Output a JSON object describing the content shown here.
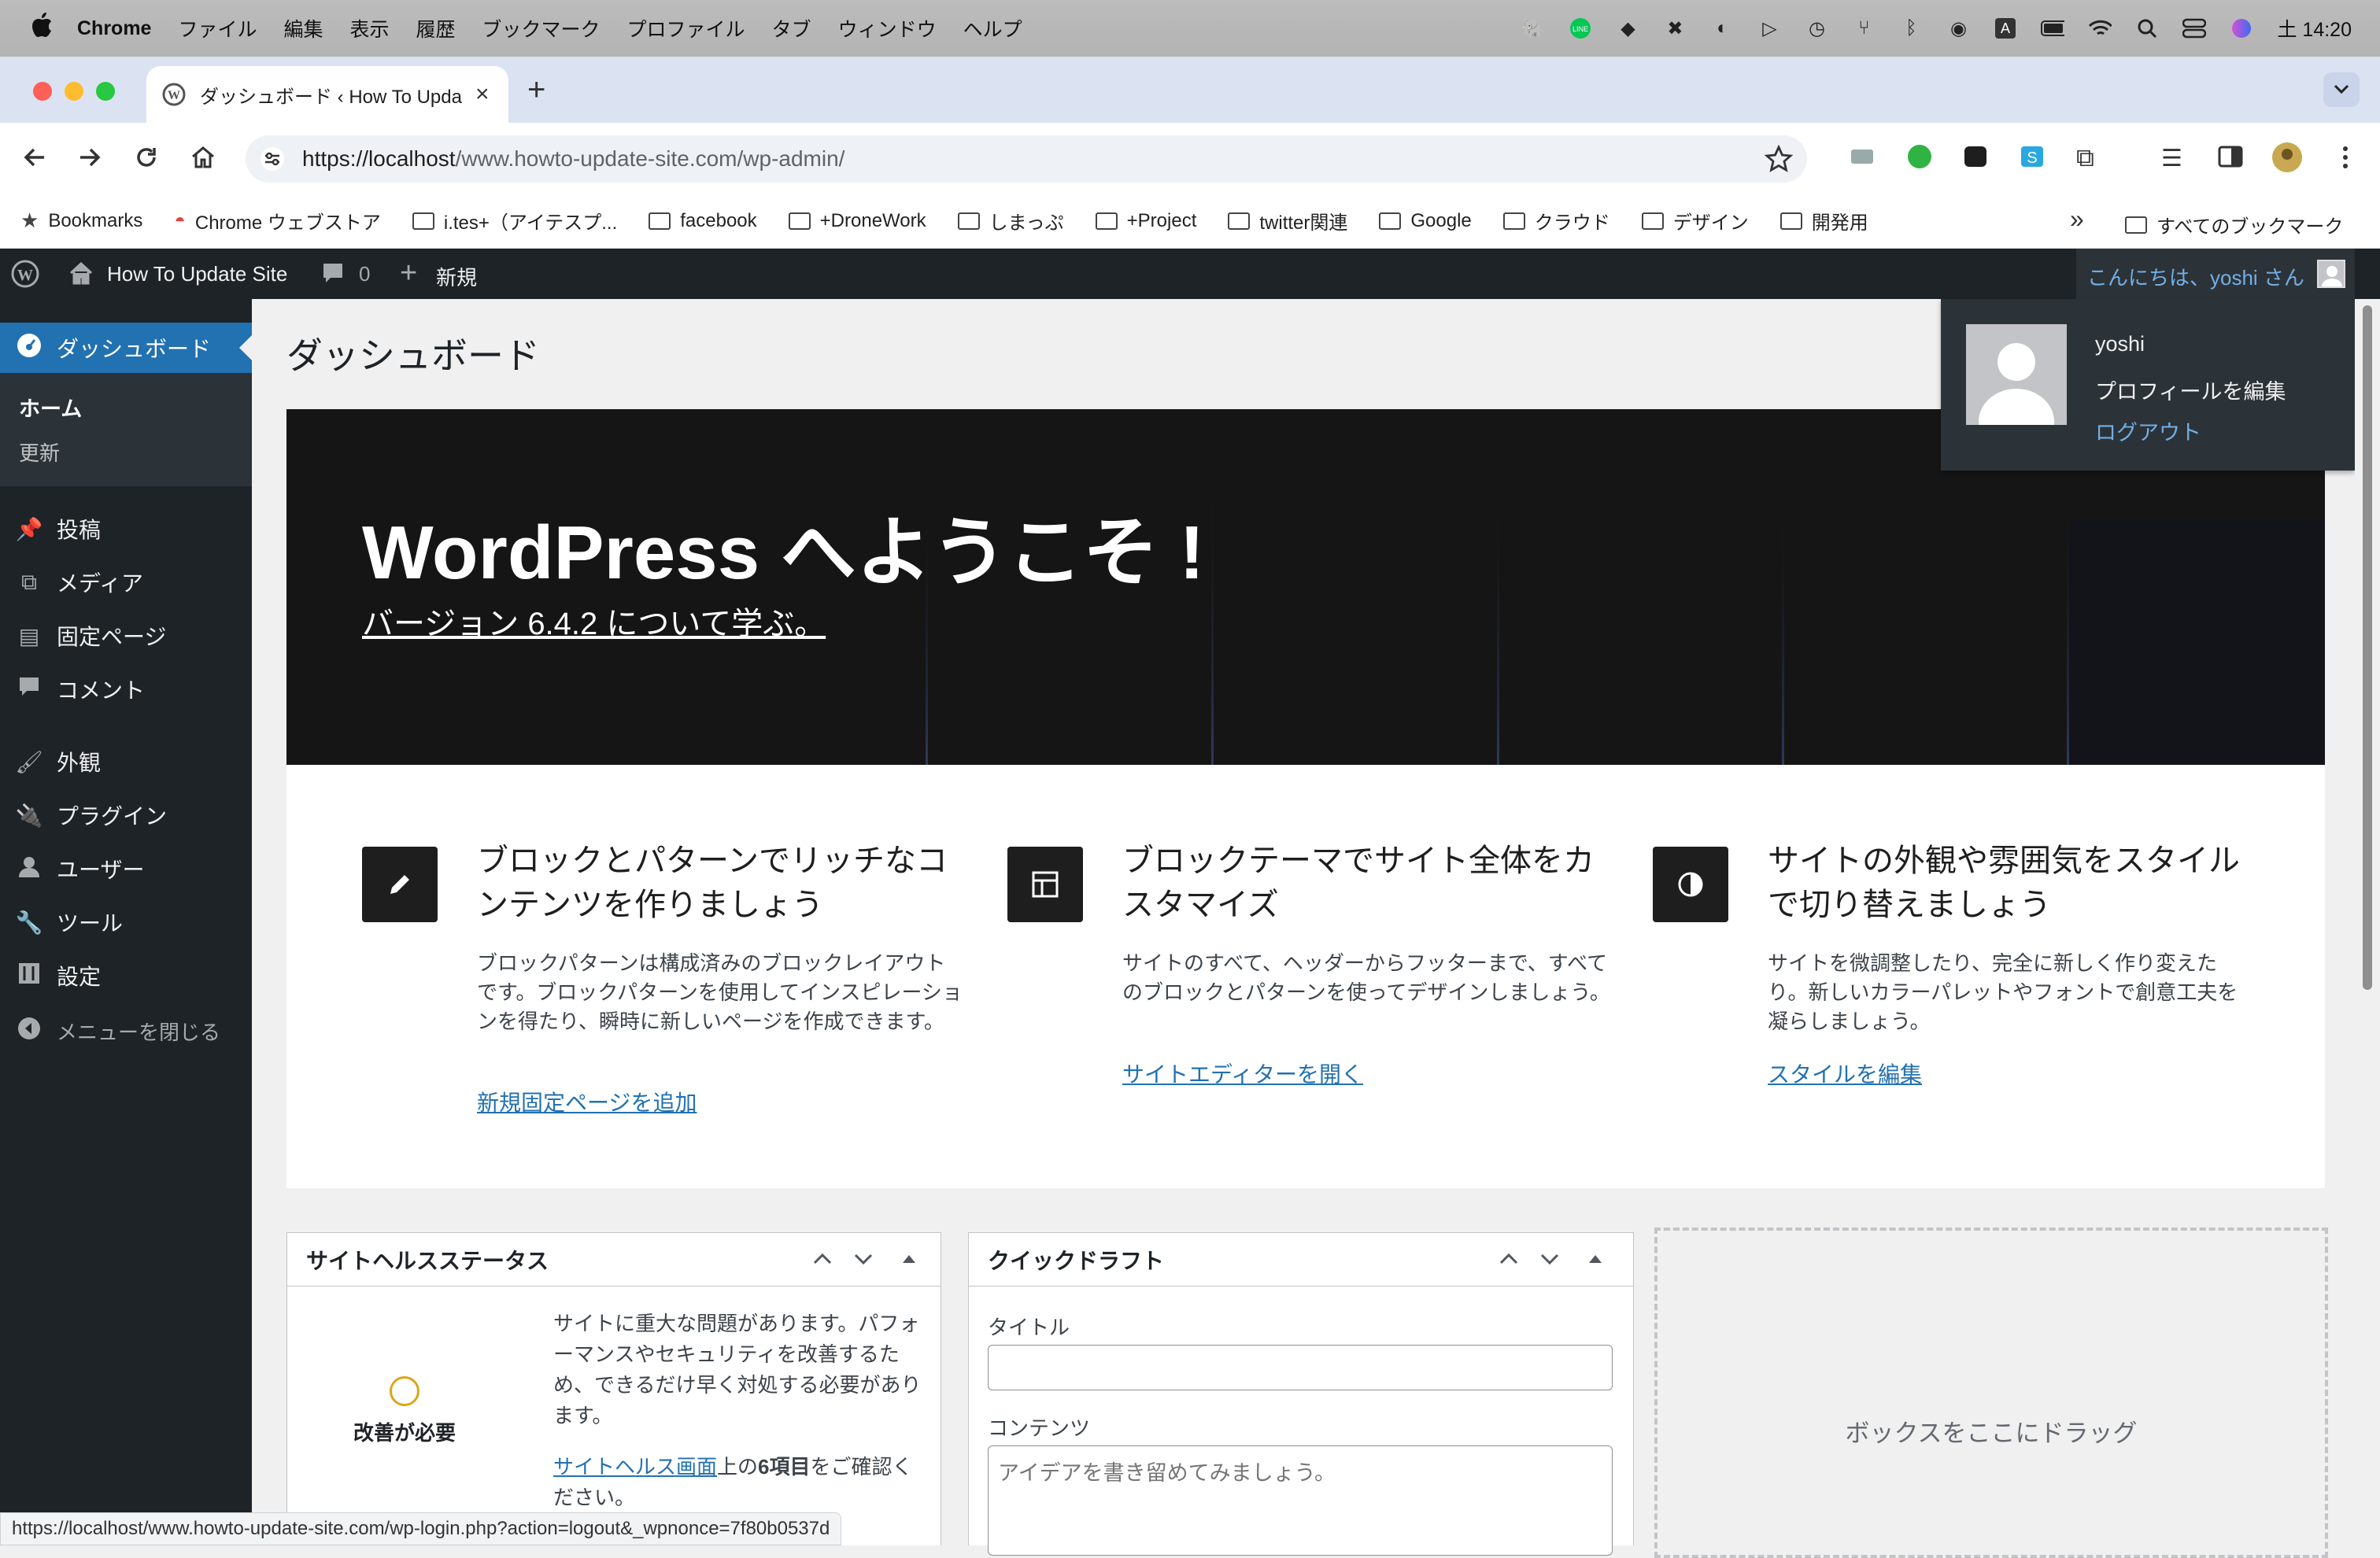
{
  "mac_menubar": {
    "app_name": "Chrome",
    "menus": [
      "ファイル",
      "編集",
      "表示",
      "履歴",
      "ブックマーク",
      "プロファイル",
      "タブ",
      "ウィンドウ",
      "ヘルプ"
    ],
    "clock": "土 14:20"
  },
  "browser": {
    "tab_title": "ダッシュボード ‹ How To Upda",
    "url_host": "https://localhost",
    "url_path": "/www.howto-update-site.com/wp-admin/",
    "bookmarks": [
      "Bookmarks",
      "Chrome ウェブストア",
      "i.tes+（アイテスプ...",
      "facebook",
      "+DroneWork",
      "しまっぷ",
      "+Project",
      "twitter関連",
      "Google",
      "クラウド",
      "デザイン",
      "開発用"
    ],
    "all_bookmarks": "すべてのブックマーク",
    "status_url": "https://localhost/www.howto-update-site.com/wp-login.php?action=logout&_wpnonce=7f80b0537d"
  },
  "adminbar": {
    "site_name": "How To Update Site",
    "comment_count": "0",
    "new_label": "新規",
    "greeting": "こんにちは、yoshi さん",
    "dropdown": {
      "username": "yoshi",
      "edit_profile": "プロフィールを編集",
      "logout": "ログアウト"
    }
  },
  "sidebar": {
    "dashboard": "ダッシュボード",
    "home": "ホーム",
    "updates": "更新",
    "posts": "投稿",
    "media": "メディア",
    "pages": "固定ページ",
    "comments": "コメント",
    "appearance": "外観",
    "plugins": "プラグイン",
    "users": "ユーザー",
    "tools": "ツール",
    "settings": "設定",
    "collapse": "メニューを閉じる"
  },
  "main": {
    "page_title": "ダッシュボード",
    "welcome_heading": "WordPress へようこそ !",
    "welcome_link": "バージョン 6.4.2 について学ぶ。",
    "columns": [
      {
        "title": "ブロックとパターンでリッチなコンテンツを作りましょう",
        "desc": "ブロックパターンは構成済みのブロックレイアウトです。ブロックパターンを使用してインスピレーションを得たり、瞬時に新しいページを作成できます。",
        "link": "新規固定ページを追加"
      },
      {
        "title": "ブロックテーマでサイト全体をカスタマイズ",
        "desc": "サイトのすべて、ヘッダーからフッターまで、すべてのブロックとパターンを使ってデザインしましょう。",
        "link": "サイトエディターを開く"
      },
      {
        "title": "サイトの外観や雰囲気をスタイルで切り替えましょう",
        "desc": "サイトを微調整したり、完全に新しく作り変えたり。新しいカラーパレットやフォントで創意工夫を凝らしましょう。",
        "link": "スタイルを編集"
      }
    ],
    "site_health": {
      "title": "サイトヘルスステータス",
      "status": "改善が必要",
      "message": "サイトに重大な問題があります。パフォーマンスやセキュリティを改善するため、できるだけ早く対処する必要があります。",
      "link": "サイトヘルス画面",
      "suffix_1": "上の",
      "count": "6項目",
      "suffix_2": "をご確認ください。"
    },
    "quick_draft": {
      "title": "クイックドラフト",
      "title_label": "タイトル",
      "content_label": "コンテンツ",
      "content_placeholder": "アイデアを書き留めてみましょう。"
    },
    "drop_zone": "ボックスをここにドラッグ"
  },
  "colors": {
    "admin_dark": "#1d2327",
    "accent_blue": "#2271b1",
    "active_menu": "#2271b1"
  }
}
